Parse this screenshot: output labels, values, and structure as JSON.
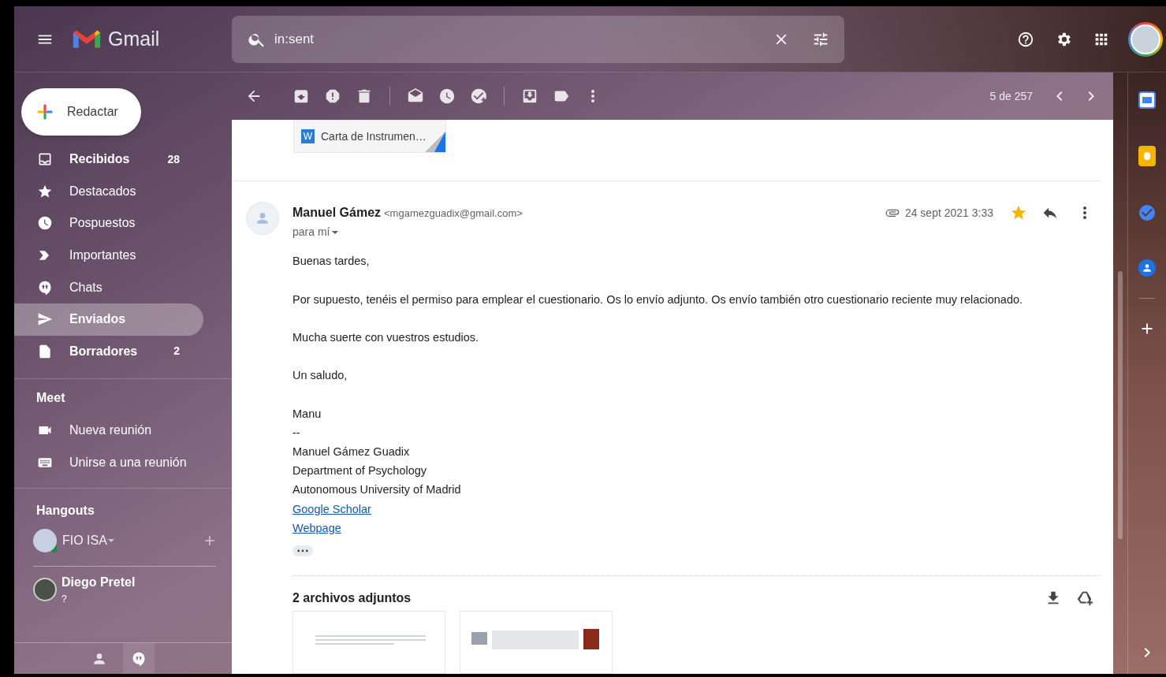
{
  "header": {
    "app_name": "Gmail",
    "search": {
      "value": "in:sent"
    }
  },
  "compose": {
    "label": "Redactar"
  },
  "sidebar": {
    "items": [
      {
        "label": "Recibidos",
        "count": "28",
        "unread": true,
        "selected": false
      },
      {
        "label": "Destacados",
        "unread": false,
        "selected": false
      },
      {
        "label": "Pospuestos",
        "unread": false,
        "selected": false
      },
      {
        "label": "Importantes",
        "unread": false,
        "selected": false
      },
      {
        "label": "Chats",
        "unread": false,
        "selected": false
      },
      {
        "label": "Enviados",
        "unread": true,
        "selected": true
      },
      {
        "label": "Borradores",
        "count": "2",
        "unread": true,
        "selected": false
      }
    ],
    "meet": {
      "title": "Meet",
      "items": [
        {
          "label": "Nueva reunión"
        },
        {
          "label": "Unirse a una reunión"
        }
      ]
    },
    "hangouts": {
      "title": "Hangouts",
      "user": {
        "name": "FIO ISA",
        "online": true
      },
      "contacts": [
        {
          "name": "Diego Pretel",
          "status": "?"
        }
      ]
    }
  },
  "toolbar": {
    "pager": "5 de 257"
  },
  "previous_attachment": {
    "file_type": "W",
    "name": "Carta de Instrumen…"
  },
  "message": {
    "sender_name": "Manuel Gámez",
    "sender_email": "<mgamezguadix@gmail.com>",
    "recipient": "para mí",
    "date": "24 sept 2021 3:33",
    "starred": true,
    "body": [
      "Buenas tardes,",
      "Por supuesto, tenéis el permiso para emplear el cuestionario. Os lo envío adjunto. Os envío también otro cuestionario reciente muy relacionado.",
      "Mucha suerte con vuestros estudios.",
      "Un saludo,",
      "Manu"
    ],
    "signature": [
      "--",
      "Manuel Gámez Guadix",
      "Department of Psychology",
      "Autonomous University of Madrid"
    ],
    "links": [
      "Google Scholar",
      "Webpage"
    ]
  },
  "attachments": {
    "title": "2 archivos adjuntos"
  }
}
